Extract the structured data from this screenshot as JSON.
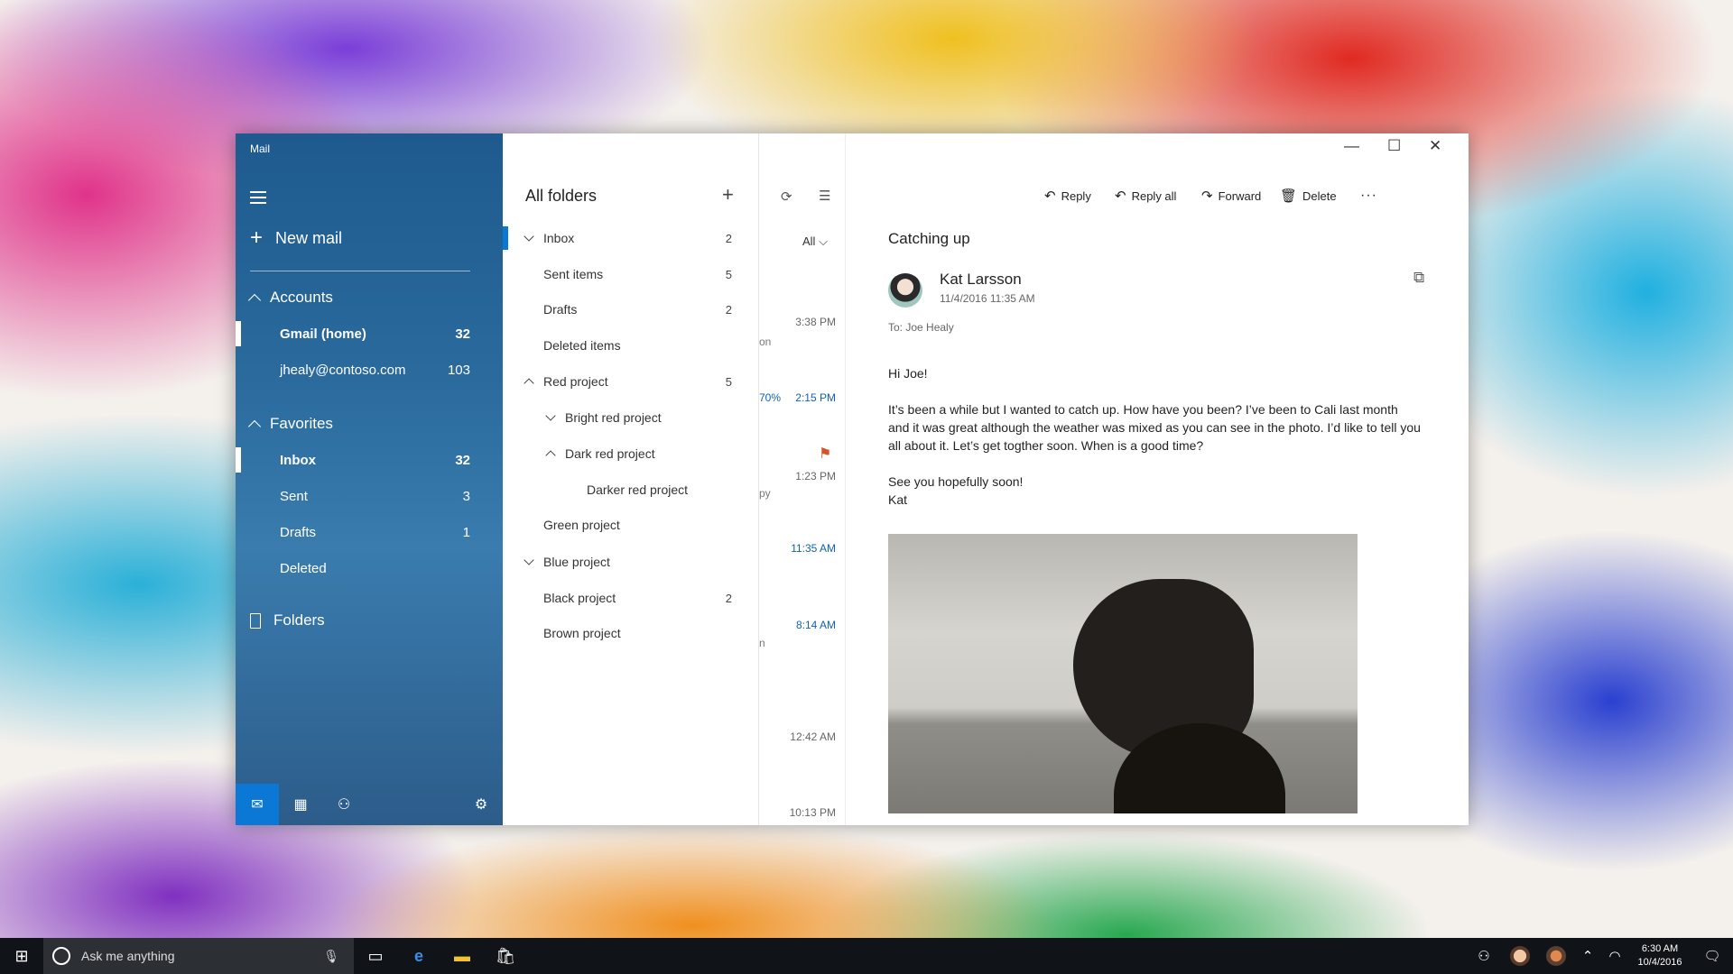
{
  "nav": {
    "title": "Mail",
    "new_mail": "New mail",
    "accounts": "Accounts",
    "account_items": [
      {
        "label": "Gmail (home)",
        "count": "32"
      },
      {
        "label": "jhealy@contoso.com",
        "count": "103"
      }
    ],
    "favorites": "Favorites",
    "favorite_items": [
      {
        "label": "Inbox",
        "count": "32"
      },
      {
        "label": "Sent",
        "count": "3"
      },
      {
        "label": "Drafts",
        "count": "1"
      },
      {
        "label": "Deleted",
        "count": ""
      }
    ],
    "folders": "Folders"
  },
  "folder_pane": {
    "header": "All folders",
    "items": [
      {
        "label": "Inbox",
        "count": "2"
      },
      {
        "label": "Sent items",
        "count": "5"
      },
      {
        "label": "Drafts",
        "count": "2"
      },
      {
        "label": "Deleted items",
        "count": ""
      },
      {
        "label": "Red project",
        "count": "5"
      },
      {
        "label": "Bright red project",
        "count": ""
      },
      {
        "label": "Dark red project",
        "count": ""
      },
      {
        "label": "Darker red project",
        "count": ""
      },
      {
        "label": "Green project",
        "count": ""
      },
      {
        "label": "Blue project",
        "count": ""
      },
      {
        "label": "Black project",
        "count": "2"
      },
      {
        "label": "Brown project",
        "count": ""
      }
    ]
  },
  "message_list": {
    "filter": "All",
    "times": [
      "3:38 PM",
      "2:15 PM",
      "1:23 PM",
      "11:35 AM",
      "8:14 AM",
      "12:42 AM",
      "10:13 PM"
    ],
    "fragments": [
      "on",
      "70%",
      "py",
      "n"
    ]
  },
  "toolbar": {
    "reply": "Reply",
    "reply_all": "Reply all",
    "forward": "Forward",
    "delete": "Delete",
    "more": "···"
  },
  "message": {
    "subject": "Catching up",
    "sender": "Kat Larsson",
    "date": "11/4/2016 11:35 AM",
    "to": "To: Joe Healy",
    "greeting": "Hi Joe!",
    "body": "It’s been a while but I wanted to catch up. How have you been? I’ve been to Cali last month and it was great although the weather was mixed as you can see in the photo. I’d like to tell you all about it. Let’s get togther soon. When is a good time?",
    "closing": "See you hopefully soon!",
    "signature": "Kat"
  },
  "taskbar": {
    "search_placeholder": "Ask me anything",
    "time": "6:30 AM",
    "date": "10/4/2016"
  },
  "colors": {
    "nav_accent": "#0a78d4",
    "selection_bar": "#0a78d4",
    "flag": "#d2552a",
    "link_time": "#1060b8"
  }
}
